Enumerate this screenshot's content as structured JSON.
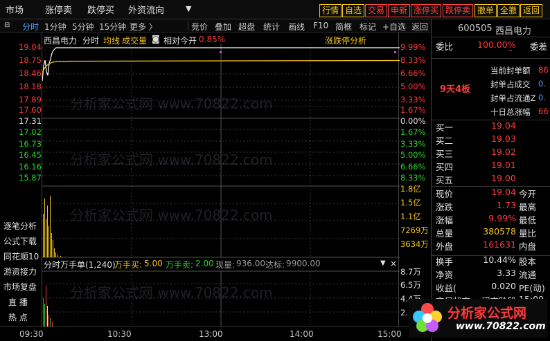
{
  "top_tabs": [
    "市场",
    "涨停卖",
    "跌停买",
    "外资流向"
  ],
  "toolbar": {
    "buttons": [
      {
        "label": "行情",
        "color": "#f5c518"
      },
      {
        "label": "自选",
        "color": "#f5c518"
      },
      {
        "label": "交易",
        "color": "#ff4040"
      },
      {
        "label": "申新",
        "color": "#ff4040"
      },
      {
        "label": "涨停买",
        "color": "#ff4040"
      },
      {
        "label": "跌停卖",
        "color": "#ff4040"
      },
      {
        "label": "撤单",
        "color": "#f5c518"
      },
      {
        "label": "全撤",
        "color": "#f5c518"
      },
      {
        "label": "返回",
        "color": "#f5c518"
      }
    ]
  },
  "sub_bar": {
    "period_tabs": [
      "分时",
      "1分钟",
      "5分钟",
      "15分钟",
      "更多 〉"
    ],
    "tools": [
      "竞价",
      "叠加",
      "超盘",
      "统计",
      "画线",
      "F10",
      "简框",
      "标记",
      "+自选",
      "返回"
    ]
  },
  "chart_header": {
    "stock_name": "西昌电力",
    "mode": "分时",
    "avg_label": "均线",
    "vol_label": "成交量",
    "compare_label": "相对今开",
    "compare_value": "0.85%",
    "analysis": "涨跌停分析"
  },
  "price_axis_left": [
    {
      "label": "19.04",
      "color": "red"
    },
    {
      "label": "18.75",
      "color": "red"
    },
    {
      "label": "18.46",
      "color": "red"
    },
    {
      "label": "18.18",
      "color": "red"
    },
    {
      "label": "17.89",
      "color": "red"
    },
    {
      "label": "17.60",
      "color": "red"
    },
    {
      "label": "17.31",
      "color": "white"
    },
    {
      "label": "17.02",
      "color": "green"
    },
    {
      "label": "16.73",
      "color": "green"
    },
    {
      "label": "16.45",
      "color": "green"
    },
    {
      "label": "16.16",
      "color": "green"
    },
    {
      "label": "15.87",
      "color": "green"
    }
  ],
  "pct_axis_right": [
    {
      "label": "9.99%",
      "color": "red"
    },
    {
      "label": "8.33%",
      "color": "red"
    },
    {
      "label": "6.66%",
      "color": "red"
    },
    {
      "label": "5.00%",
      "color": "red"
    },
    {
      "label": "3.33%",
      "color": "red"
    },
    {
      "label": "1.67%",
      "color": "red"
    },
    {
      "label": "0.00%",
      "color": "white"
    },
    {
      "label": "1.67%",
      "color": "green"
    },
    {
      "label": "3.33%",
      "color": "green"
    },
    {
      "label": "5.00%",
      "color": "green"
    },
    {
      "label": "6.66%",
      "color": "green"
    },
    {
      "label": "8.33%",
      "color": "green"
    }
  ],
  "volume_axis": [
    "1.8亿",
    "1.5亿",
    "1.1亿",
    "7269万",
    "3634万"
  ],
  "side_menu": [
    "逐笔分析",
    "公式下载",
    "同花顺10",
    "游资接力",
    "市场复盘",
    "直  播",
    "热  点"
  ],
  "lower_header": {
    "title": "分时万手单(1,240)",
    "buy_label": "万手买:",
    "buy_value": "5.00",
    "sell_label": "万手卖:",
    "sell_value": "2.00",
    "current_label": "现量:",
    "current_value": "936.00",
    "target_label": "达标:",
    "target_value": "9900.00"
  },
  "lower_axis": [
    "8.7万",
    "6.5万",
    "4.4万",
    "2.2万"
  ],
  "time_axis": [
    "09:30",
    "10:30",
    "13:00",
    "14:00",
    "15:00"
  ],
  "quote_panel": {
    "code": "600505",
    "name": "西昌电力",
    "weibi_label": "委比",
    "weibi_value": "100.00%",
    "weicha_label": "委差",
    "streak": "9天4板",
    "seal_rows": [
      "当前封单额",
      "封单占成交",
      "封单占流通Z",
      "十日总涨幅"
    ],
    "seal_values": [
      "86",
      "0.",
      "0.",
      "66"
    ],
    "bids": [
      {
        "label": "买一",
        "price": "19.04"
      },
      {
        "label": "买二",
        "price": "19.03"
      },
      {
        "label": "买三",
        "price": "19.02"
      },
      {
        "label": "买四",
        "price": "19.01"
      },
      {
        "label": "买五",
        "price": "19.00"
      }
    ],
    "stats": [
      {
        "l1": "现价",
        "v1": "19.04",
        "c1": "red",
        "l2": "今开"
      },
      {
        "l1": "涨跌",
        "v1": "1.73",
        "c1": "red",
        "l2": "最高"
      },
      {
        "l1": "涨幅",
        "v1": "9.99%",
        "c1": "red",
        "l2": "最低"
      },
      {
        "l1": "总量",
        "v1": "380578",
        "c1": "yellow",
        "l2": "量比"
      },
      {
        "l1": "外盘",
        "v1": "161631",
        "c1": "red",
        "l2": "内盘"
      }
    ],
    "stats2": [
      {
        "l1": "换手",
        "v1": "10.44%",
        "l2": "股本"
      },
      {
        "l1": "净资",
        "v1": "3.33",
        "l2": "流通"
      },
      {
        "l1": "收益(",
        "v1": "0.020",
        "l2": "PE(动)"
      },
      {
        "l1": "交易状态",
        "v1": "闭市阶段",
        "l2": "15:00"
      }
    ]
  },
  "watermark_text": "分析家公式网 www.70822.com",
  "logo": {
    "title": "分析家公式网",
    "url": "www.70822.com"
  },
  "colors": {
    "up": "#ff3b3b",
    "down": "#2fd02f",
    "avg": "#f5c518",
    "price": "#ffffff"
  }
}
